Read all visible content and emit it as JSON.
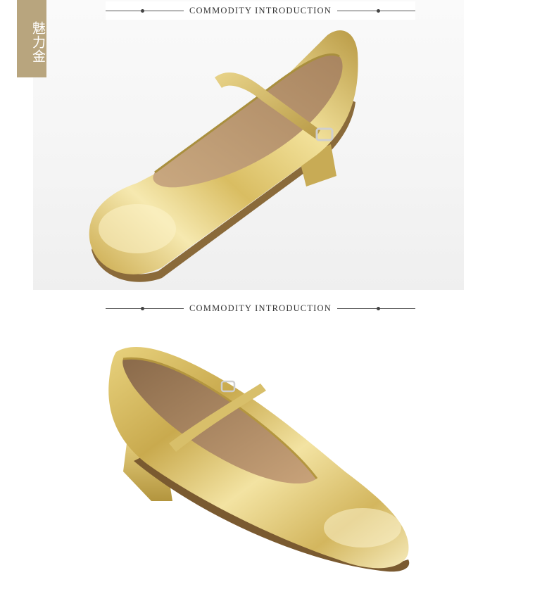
{
  "color_tag": {
    "label": "魅力金"
  },
  "sections": [
    {
      "header": "COMMODITY INTRODUCTION",
      "image": "gold-mary-jane-shoe-top-view-icon"
    },
    {
      "header": "COMMODITY INTRODUCTION",
      "image": "gold-mary-jane-shoe-side-view-icon"
    }
  ],
  "colors": {
    "tag_background": "#b8a57e",
    "gold_light": "#f4e6a6",
    "gold_mid": "#d8bf6a",
    "gold_dark": "#9c8233",
    "insole": "#b48e66",
    "rule": "#555555"
  }
}
